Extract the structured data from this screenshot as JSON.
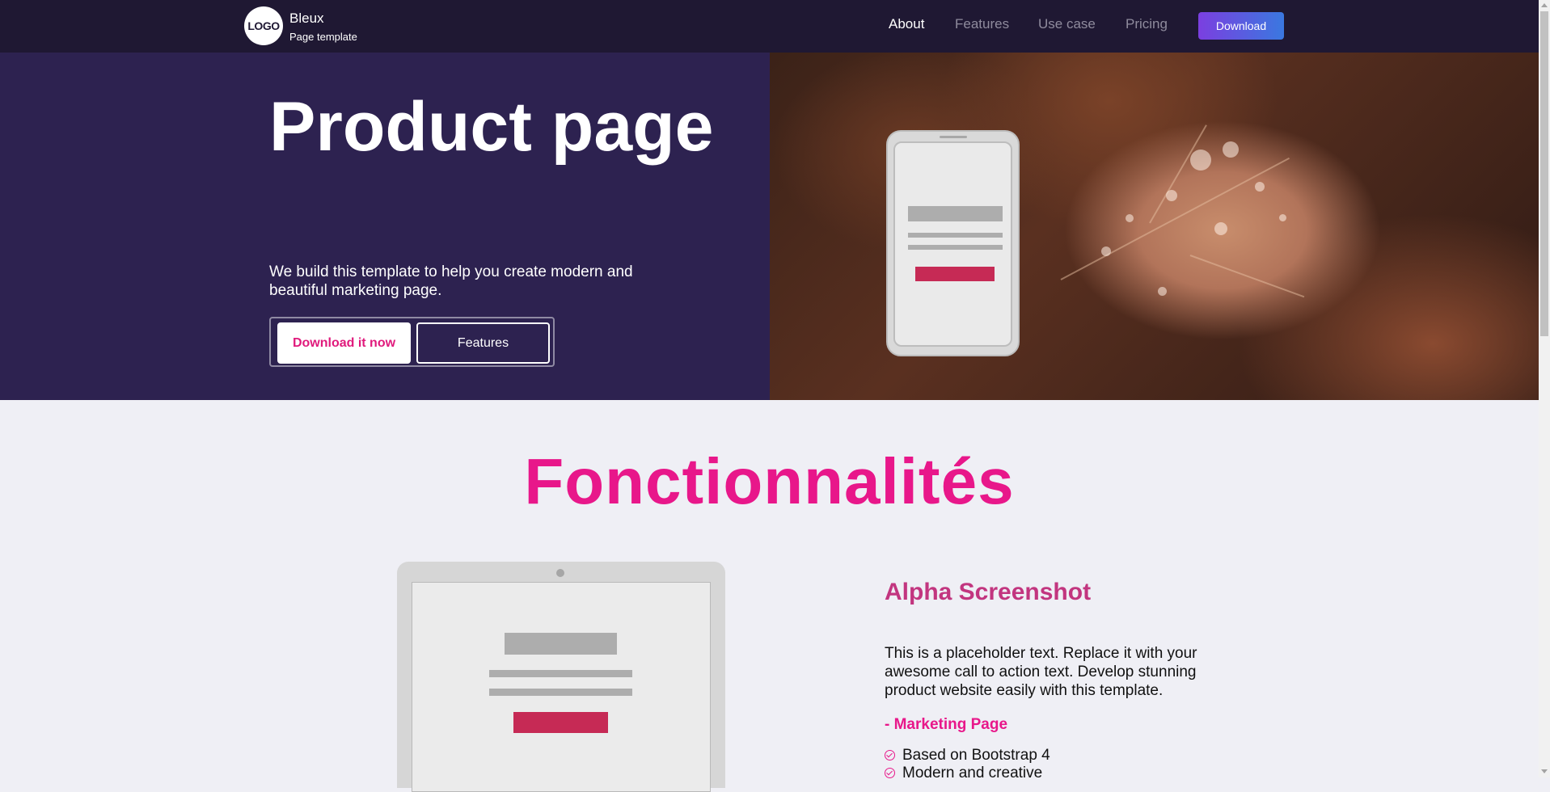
{
  "navbar": {
    "logo_text": "LOGO",
    "brand_name": "Bleux",
    "brand_subtitle": "Page template",
    "links": [
      {
        "label": "About",
        "active": true
      },
      {
        "label": "Features",
        "active": false
      },
      {
        "label": "Use case",
        "active": false
      },
      {
        "label": "Pricing",
        "active": false
      }
    ],
    "download_label": "Download"
  },
  "hero": {
    "title": "Product page",
    "text": "We build this template to help you create modern and beautiful marketing page.",
    "primary_button": "Download it now",
    "secondary_button": "Features"
  },
  "features": {
    "title": "Fonctionnalités",
    "heading": "Alpha Screenshot",
    "text": "This is a placeholder text. Replace it with your awesome call to action text. Develop stunning product website easily with this template.",
    "subheading": "- Marketing Page",
    "items": [
      "Based on Bootstrap 4",
      "Modern and creative"
    ]
  },
  "colors": {
    "nav_bg": "#1f1833",
    "hero_bg": "#2d2250",
    "accent_pink": "#e8178a",
    "heading_pink": "#c2357f",
    "download_gradient_start": "#7b3fe0",
    "download_gradient_end": "#3a78e0"
  },
  "icons": [
    "check-circle-icon"
  ]
}
